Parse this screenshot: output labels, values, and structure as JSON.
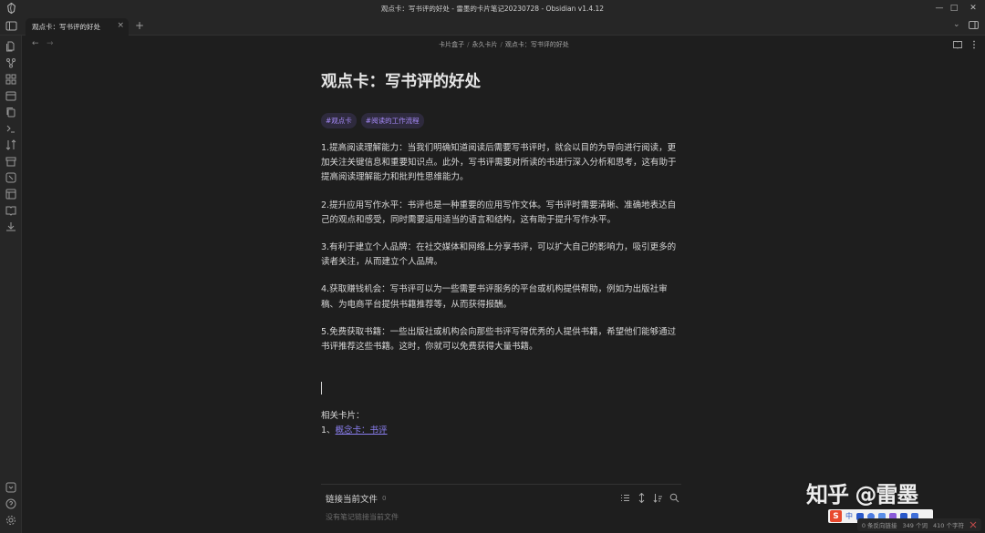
{
  "window": {
    "title": "观点卡：写书评的好处 - 雷墨的卡片笔记20230728 - Obsidian v1.4.12",
    "minimize": "—",
    "maximize": "□",
    "close": "✕"
  },
  "tabs": [
    {
      "label": "观点卡：写书评的好处",
      "close": "×"
    }
  ],
  "tabbar": {
    "new_tab": "+",
    "menu": "⌄"
  },
  "nav": {
    "back": "←",
    "forward": "→",
    "breadcrumb": [
      "卡片盒子",
      "永久卡片",
      "观点卡：写书评的好处"
    ],
    "separator": "/"
  },
  "note": {
    "title": "观点卡：写书评的好处",
    "tags": [
      "#观点卡",
      "#阅读的工作流程"
    ],
    "paragraphs": [
      "1.提高阅读理解能力：当我们明确知道阅读后需要写书评时，就会以目的为导向进行阅读，更加关注关键信息和重要知识点。此外，写书评需要对所读的书进行深入分析和思考，这有助于提高阅读理解能力和批判性思维能力。",
      "2.提升应用写作水平：书评也是一种重要的应用写作文体。写书评时需要清晰、准确地表达自己的观点和感受，同时需要运用适当的语言和结构，这有助于提升写作水平。",
      "3.有利于建立个人品牌：在社交媒体和网络上分享书评，可以扩大自己的影响力，吸引更多的读者关注，从而建立个人品牌。",
      "4.获取赚钱机会：写书评可以为一些需要书评服务的平台或机构提供帮助，例如为出版社审稿、为电商平台提供书籍推荐等，从而获得报酬。",
      "5.免费获取书籍：一些出版社或机构会向那些书评写得优秀的人提供书籍，希望他们能够通过书评推荐这些书籍。这时，你就可以免费获得大量书籍。"
    ],
    "related_title": "相关卡片：",
    "related_prefix": "1、",
    "related_link": "概念卡：书评"
  },
  "backlinks": {
    "title": "链接当前文件",
    "count": "0",
    "empty": "没有笔记链接当前文件"
  },
  "statusbar": {
    "backlinks": "0 条反向链接",
    "words": "349 个词",
    "chars": "410 个字符"
  },
  "ime": {
    "lang": "中"
  },
  "watermark": "知乎 @雷墨",
  "colors": {
    "accent": "#a68af9",
    "link": "#8b7ff0",
    "background": "#1e1e1e",
    "chrome": "#262626"
  }
}
